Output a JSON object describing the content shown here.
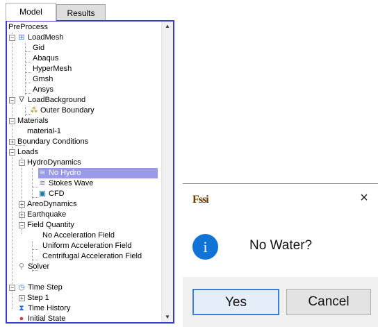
{
  "tabs": [
    {
      "label": "Model",
      "active": true
    },
    {
      "label": "Results",
      "active": false
    }
  ],
  "tree": {
    "nodes": [
      {
        "label": "PreProcess"
      },
      {
        "label": "LoadMesh",
        "icon": "grid-mesh-icon"
      },
      {
        "label": "Gid"
      },
      {
        "label": "Abaqus"
      },
      {
        "label": "HyperMesh"
      },
      {
        "label": "Gmsh"
      },
      {
        "label": "Ansys"
      },
      {
        "label": "LoadBackground",
        "icon": "funnel-icon"
      },
      {
        "label": "Outer Boundary",
        "icon": "boundary-icon"
      },
      {
        "label": "Materials"
      },
      {
        "label": "material-1"
      },
      {
        "label": "Boundary Conditions"
      },
      {
        "label": "Loads"
      },
      {
        "label": "HydroDynamics"
      },
      {
        "label": "No Hydro",
        "icon": "wave-off-icon",
        "selected": true
      },
      {
        "label": "Stokes Wave",
        "icon": "wave-icon"
      },
      {
        "label": "CFD",
        "icon": "cfd-icon"
      },
      {
        "label": "AreoDynamics"
      },
      {
        "label": "Earthquake"
      },
      {
        "label": "Field Quantity"
      },
      {
        "label": "No Acceleration Field"
      },
      {
        "label": "Uniform Acceleration Field"
      },
      {
        "label": "Centrifugal Acceleration Field"
      },
      {
        "label": "Solver",
        "icon": "magnifier-icon"
      },
      {
        "label": "Time Step",
        "icon": "clock-icon"
      },
      {
        "label": "Step 1"
      },
      {
        "label": "Time History",
        "icon": "time-history-icon"
      },
      {
        "label": "Initial State",
        "icon": "initial-state-icon"
      }
    ]
  },
  "dialog": {
    "logo_text": "Fssi",
    "close_glyph": "×",
    "info_glyph": "i",
    "message": "No Water?",
    "yes_label": "Yes",
    "cancel_label": "Cancel"
  },
  "colors": {
    "selection": "#9a9ae8",
    "panel_border": "#3a3ad6",
    "info_icon": "#1273d6",
    "default_button_border": "#3c7fd6"
  }
}
